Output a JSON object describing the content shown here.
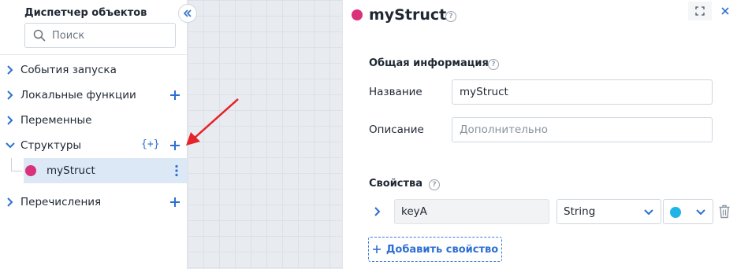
{
  "sidebar": {
    "title": "Диспетчер объектов",
    "search_placeholder": "Поиск",
    "items": [
      {
        "label": "События запуска"
      },
      {
        "label": "Локальные функции"
      },
      {
        "label": "Переменные"
      },
      {
        "label": "Структуры",
        "braces": "{+}"
      },
      {
        "label": "Перечисления"
      }
    ],
    "child": {
      "label": "myStruct",
      "color": "#d9317a"
    }
  },
  "panel": {
    "title": "myStruct",
    "accent_color": "#d9317a",
    "help_glyph": "?",
    "general_section": "Общая информация",
    "name_label": "Название",
    "name_value": "myStruct",
    "description_label": "Описание",
    "description_placeholder": "Дополнительно",
    "props_section": "Свойства",
    "property": {
      "name": "keyA",
      "type": "String",
      "color": "#1fb3e8"
    },
    "add_property": "Добавить свойство"
  }
}
